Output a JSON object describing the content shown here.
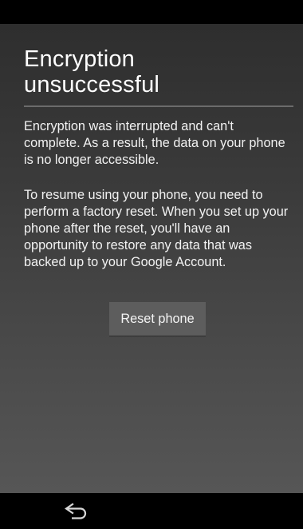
{
  "dialog": {
    "title_line1": "Encryption",
    "title_line2": "unsuccessful",
    "message_paragraph1": "Encryption was interrupted and can't complete. As a result, the data on your phone is no longer accessible.",
    "message_paragraph2": "To resume using your phone, you need to perform a factory reset. When you set up your phone after the reset, you'll have an opportunity to restore any data that was backed up to your Google Account.",
    "reset_button_label": "Reset phone"
  },
  "nav_bar": {
    "back_icon": "back-arrow-icon"
  },
  "colors": {
    "background_top": "#2e2e2e",
    "background_bottom": "#565656",
    "button_background": "#5d5d5d",
    "divider": "#6b6b6b",
    "text": "#ffffff"
  }
}
